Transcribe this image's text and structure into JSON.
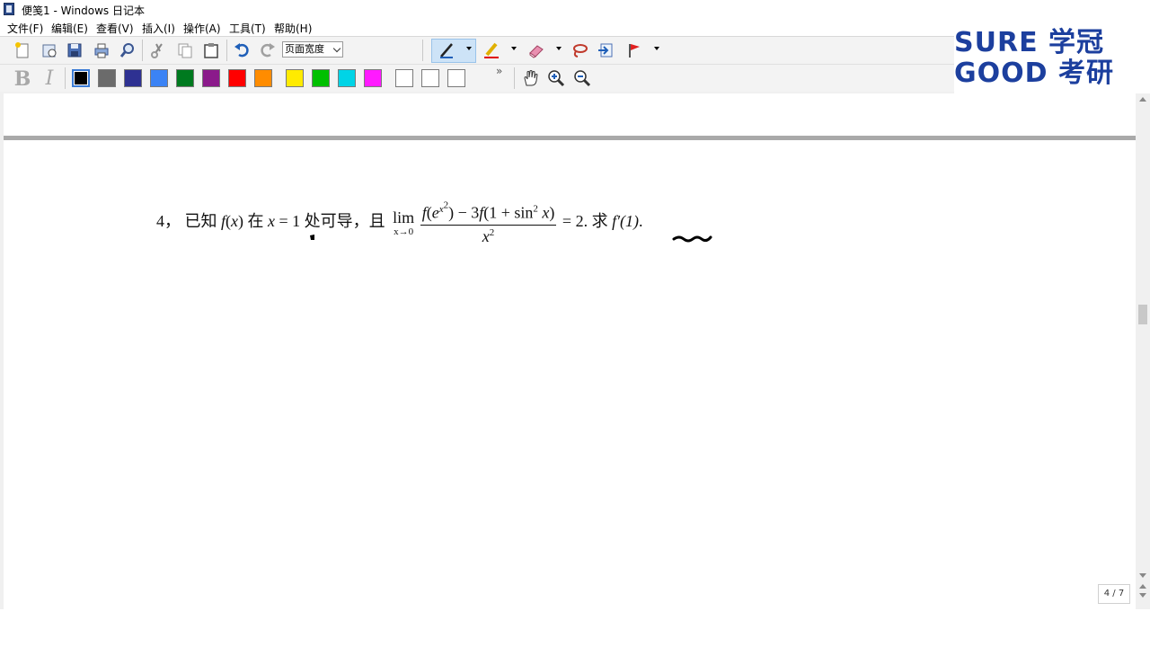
{
  "window": {
    "title": "便笺1 - Windows 日记本"
  },
  "menu": [
    "文件(F)",
    "编辑(E)",
    "查看(V)",
    "插入(I)",
    "操作(A)",
    "工具(T)",
    "帮助(H)"
  ],
  "toolbar": {
    "zoom_value": "页面宽度",
    "icons": [
      "new-note-icon",
      "open-icon",
      "save-icon",
      "print-icon",
      "search-icon",
      "cut-icon",
      "copy-icon",
      "paste-icon",
      "undo-icon",
      "redo-icon",
      "pen-icon",
      "highlighter-icon",
      "eraser-icon",
      "lasso-icon",
      "insert-space-icon",
      "flag-icon",
      "hand-icon",
      "zoom-in-icon",
      "zoom-out-icon"
    ],
    "colors": [
      "#000000",
      "#6b6b6b",
      "#2e3192",
      "#3b83f5",
      "#007a1f",
      "#8b1a8b",
      "#ff0000",
      "#ff8c00",
      "#ffeb00",
      "#00c000",
      "#00d4e6",
      "#ff1aff",
      "#ffffff",
      "#ffffff",
      "#ffffff"
    ],
    "bold_label": "B",
    "italic_label": "I",
    "more_label": "»"
  },
  "logo": {
    "line1": "SURE 学冠",
    "line2": "GOOD 考研"
  },
  "problem": {
    "number": "4，",
    "t1": "已知",
    "t2": "在",
    "t3": "处可导，且",
    "lim_word": "lim",
    "lim_sub": "x→0",
    "equals": "= 2.",
    "t4": "求",
    "target": "f′(1)",
    "end": "."
  },
  "page_indicator": "4 / 7",
  "accent_colors": {
    "logo_blue": "#1c3f9e",
    "active_tool": "#cde3f7"
  }
}
